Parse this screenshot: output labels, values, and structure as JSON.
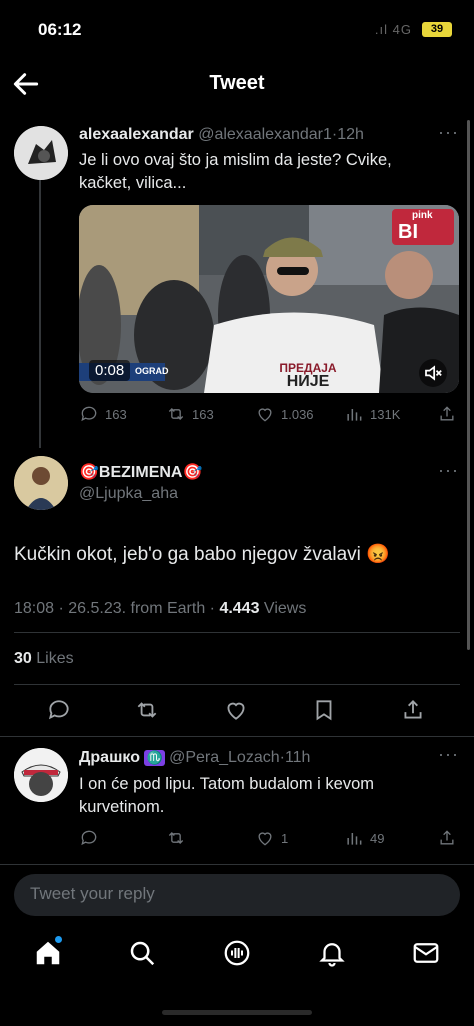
{
  "status_bar": {
    "time": "06:12",
    "signal": ".ıl 4G",
    "battery": "39"
  },
  "header": {
    "title": "Tweet"
  },
  "parent_tweet": {
    "name": "alexaalexandar",
    "handle": "@alexaalexandar1",
    "sep": "·",
    "time": "12h",
    "text": "Je li ovo ovaj što ja mislim da jeste? Cvike, kačket, vilica...",
    "video_duration": "0:08",
    "video_location": "OGRAD",
    "overlay_brand": "pink",
    "overlay_tag": "BI",
    "shirt_text_line1": "ПРЕДАЈА",
    "shirt_text_line2": "НИЈЕ",
    "replies": "163",
    "retweets": "163",
    "likes": "1.036",
    "views": "131K"
  },
  "main_tweet": {
    "name": "BEZIMENA",
    "handle": "@Ljupka_aha",
    "text": "Kučkin okot, jeb'o ga babo njegov žvalavi 😡",
    "timestamp": "18:08 · 26.5.23. from Earth · ",
    "views_count": "4.443",
    "views_label": " Views",
    "likes_count": "30",
    "likes_label": " Likes"
  },
  "reply_tweet": {
    "name": "Драшко",
    "badge": "♏",
    "handle": "@Pera_Lozach",
    "sep": "·",
    "time": "11h",
    "text": "I on će pod lipu. Tatom budalom i kevom kurvetinom.",
    "likes": "1",
    "views": "49"
  },
  "reply_input": {
    "placeholder": "Tweet your reply"
  },
  "icons": [
    "back-arrow-icon",
    "reply-icon",
    "retweet-icon",
    "like-icon",
    "views-icon",
    "share-icon",
    "bookmark-icon",
    "home-icon",
    "search-icon",
    "spaces-icon",
    "notifications-icon",
    "messages-icon",
    "mute-icon"
  ],
  "colors": {
    "background": "#000000",
    "text": "#e7e9ea",
    "muted": "#71767b",
    "accent": "#1d9bf0"
  }
}
